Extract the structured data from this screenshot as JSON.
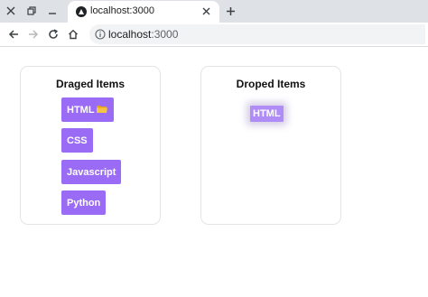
{
  "browser": {
    "tab": {
      "title": "localhost:3000"
    },
    "address": {
      "host": "localhost",
      "port": ":3000"
    }
  },
  "colors": {
    "accent": "#9a6bf5",
    "dropped_item": "#b08cf7",
    "panel_border": "#e4e4e7"
  },
  "dragged_panel": {
    "title": "Draged Items",
    "items": [
      {
        "label": "HTML",
        "icon": "folder-icon"
      },
      {
        "label": "CSS"
      },
      {
        "label": "Javascript"
      },
      {
        "label": "Python"
      }
    ]
  },
  "dropped_panel": {
    "title": "Droped Items",
    "items": [
      {
        "label": "HTML"
      }
    ]
  }
}
